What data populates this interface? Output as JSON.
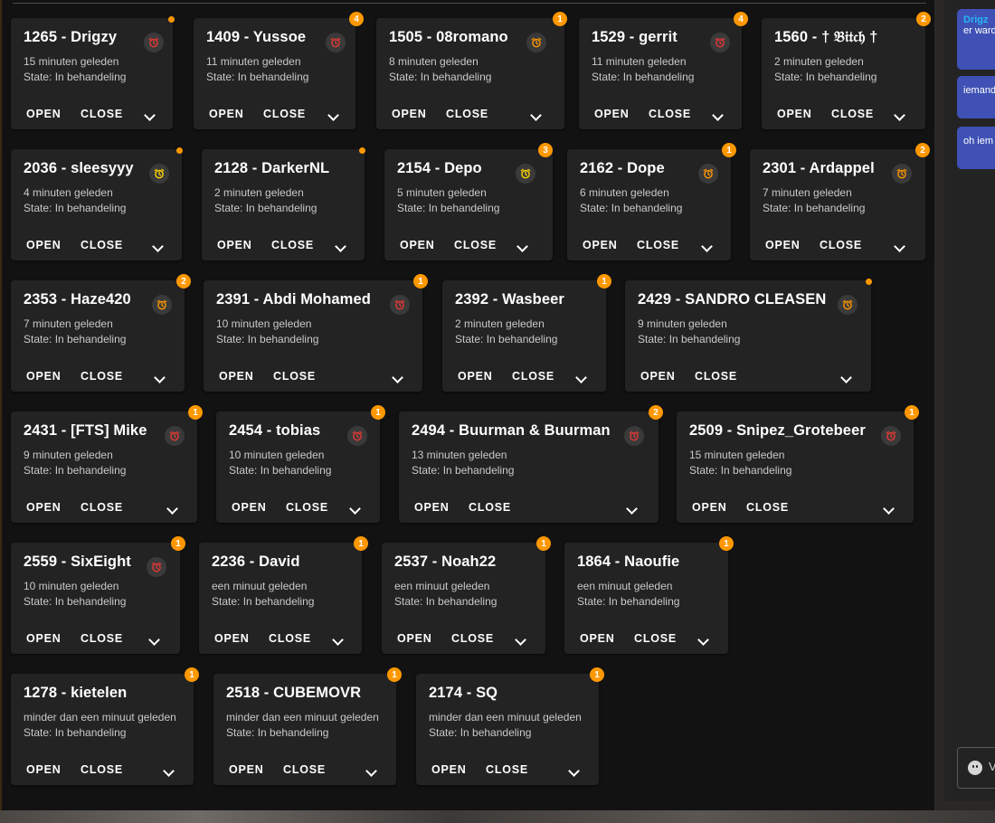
{
  "ui": {
    "open_label": "OPEN",
    "close_label": "CLOSE",
    "accent_color": "#ff9800",
    "chat_bubble_color": "#3f51b5",
    "alarm_colors": {
      "red": "#e53935",
      "orange": "#ff9800",
      "yellow": "#ffd600"
    }
  },
  "tickets": [
    {
      "title": "1265 - Drigzy",
      "time": "15 minuten geleden",
      "state": "State: In behandeling",
      "alarm": "red",
      "badge": ""
    },
    {
      "title": "1409 - Yussoe",
      "time": "11 minuten geleden",
      "state": "State: In behandeling",
      "alarm": "red",
      "badge": "4"
    },
    {
      "title": "1505 - 08romano",
      "time": "8 minuten geleden",
      "state": "State: In behandeling",
      "alarm": "orange",
      "badge": "1"
    },
    {
      "title": "1529 - gerrit",
      "time": "11 minuten geleden",
      "state": "State: In behandeling",
      "alarm": "red",
      "badge": "4"
    },
    {
      "title": "1560 - † 𝔅𝔦𝔱𝔠𝔥 †",
      "time": "2 minuten geleden",
      "state": "State: In behandeling",
      "alarm": "",
      "badge": "2"
    },
    {
      "title": "2036 - sleesyyy",
      "time": "4 minuten geleden",
      "state": "State: In behandeling",
      "alarm": "yellow",
      "badge": ""
    },
    {
      "title": "2128 - DarkerNL",
      "time": "2 minuten geleden",
      "state": "State: In behandeling",
      "alarm": "",
      "badge": ""
    },
    {
      "title": "2154 - Depo",
      "time": "5 minuten geleden",
      "state": "State: In behandeling",
      "alarm": "yellow",
      "badge": "3"
    },
    {
      "title": "2162 - Dope",
      "time": "6 minuten geleden",
      "state": "State: In behandeling",
      "alarm": "orange",
      "badge": "1"
    },
    {
      "title": "2301 - Ardappel",
      "time": "7 minuten geleden",
      "state": "State: In behandeling",
      "alarm": "orange",
      "badge": "2"
    },
    {
      "title": "2353 - Haze420",
      "time": "7 minuten geleden",
      "state": "State: In behandeling",
      "alarm": "orange",
      "badge": "2"
    },
    {
      "title": "2391 - Abdi Mohamed",
      "time": "10 minuten geleden",
      "state": "State: In behandeling",
      "alarm": "red",
      "badge": "1"
    },
    {
      "title": "2392 - Wasbeer",
      "time": "2 minuten geleden",
      "state": "State: In behandeling",
      "alarm": "",
      "badge": "1"
    },
    {
      "title": "2429 - SANDRO CLEASEN",
      "time": "9 minuten geleden",
      "state": "State: In behandeling",
      "alarm": "orange",
      "badge": ""
    },
    {
      "title": "2431 - [FTS] Mike",
      "time": "9 minuten geleden",
      "state": "State: In behandeling",
      "alarm": "red",
      "badge": "1"
    },
    {
      "title": "2454 - tobias",
      "time": "10 minuten geleden",
      "state": "State: In behandeling",
      "alarm": "red",
      "badge": "1"
    },
    {
      "title": "2494 - Buurman & Buurman",
      "time": "13 minuten geleden",
      "state": "State: In behandeling",
      "alarm": "red",
      "badge": "2"
    },
    {
      "title": "2509 - Snipez_Grotebeer",
      "time": "15 minuten geleden",
      "state": "State: In behandeling",
      "alarm": "red",
      "badge": "1"
    },
    {
      "title": "2559 - SixEight",
      "time": "10 minuten geleden",
      "state": "State: In behandeling",
      "alarm": "red",
      "badge": "1"
    },
    {
      "title": "2236 - David",
      "time": "een minuut geleden",
      "state": "State: In behandeling",
      "alarm": "",
      "badge": "1"
    },
    {
      "title": "2537 - Noah22",
      "time": "een minuut geleden",
      "state": "State: In behandeling",
      "alarm": "",
      "badge": "1"
    },
    {
      "title": "1864 - Naoufie",
      "time": "een minuut geleden",
      "state": "State: In behandeling",
      "alarm": "",
      "badge": "1"
    },
    {
      "title": "1278 - kietelen",
      "time": "minder dan een minuut geleden",
      "state": "State: In behandeling",
      "alarm": "",
      "badge": "1"
    },
    {
      "title": "2518 - CUBEMOVR",
      "time": "minder dan een minuut geleden",
      "state": "State: In behandeling",
      "alarm": "",
      "badge": "1"
    },
    {
      "title": "2174 - SQ",
      "time": "minder dan een minuut geleden",
      "state": "State: In behandeling",
      "alarm": "",
      "badge": "1"
    }
  ],
  "chat": {
    "messages": [
      {
        "sender": "Drigz",
        "text": "er ward"
      },
      {
        "sender": "",
        "text": "iemand"
      },
      {
        "sender": "",
        "text": "oh iem"
      }
    ],
    "input_placeholder": "V"
  }
}
